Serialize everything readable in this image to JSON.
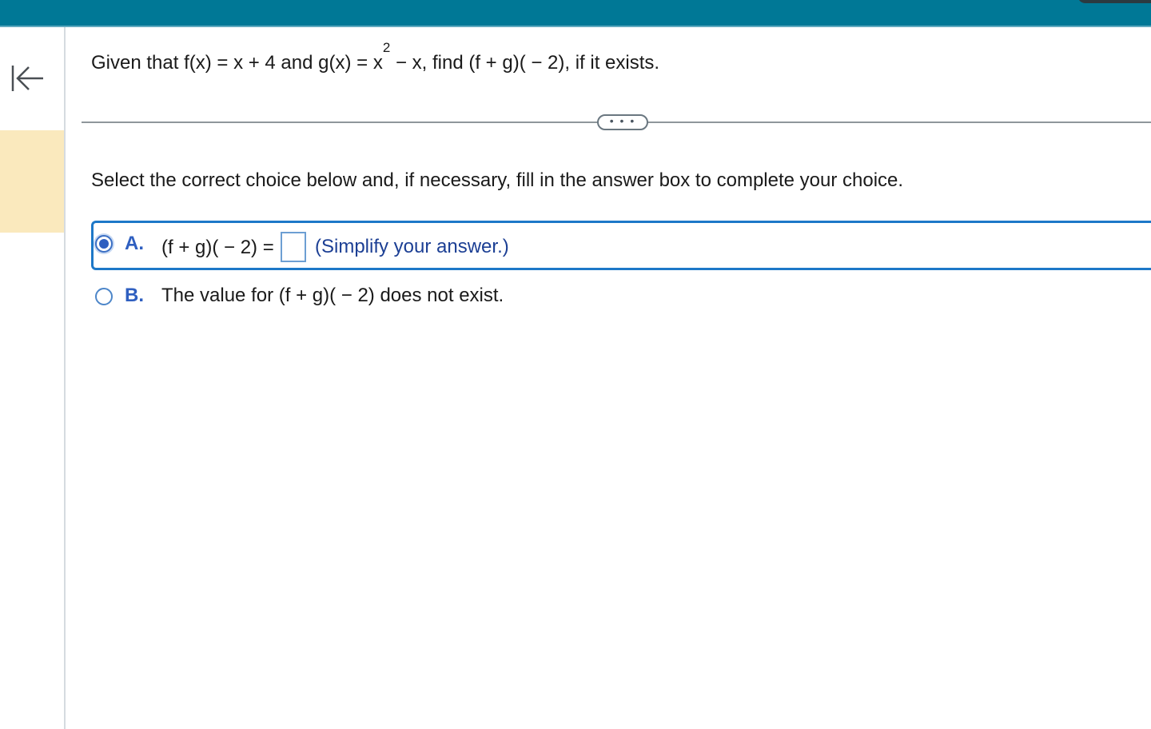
{
  "header": {
    "accent_color": "#007896"
  },
  "sidebar": {
    "collapse_icon": "collapse-left-icon",
    "highlight_color": "#fae9bd"
  },
  "question": {
    "prefix": "Given that f(x) = x + 4 and g(x) = x",
    "exponent": "2",
    "suffix": " − x, find (f + g)( − 2), if it exists."
  },
  "more_button": {
    "label": "• • •"
  },
  "instruction": "Select the correct choice below and, if necessary, fill in the answer box to complete your choice.",
  "choices": [
    {
      "letter": "A.",
      "text": "(f + g)( − 2) =",
      "selected": true,
      "answer_value": "",
      "hint": "(Simplify your answer.)"
    },
    {
      "letter": "B.",
      "text": "The value for (f + g)( − 2) does not exist.",
      "selected": false
    }
  ]
}
